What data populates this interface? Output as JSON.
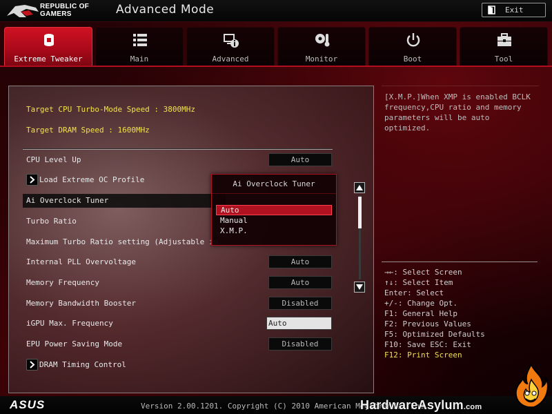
{
  "header": {
    "brand_line1": "REPUBLIC OF",
    "brand_line2": "GAMERS",
    "title": "Advanced Mode",
    "exit_label": "Exit"
  },
  "tabs": [
    {
      "label": "Extreme Tweaker",
      "icon": "tweaker-icon",
      "active": true
    },
    {
      "label": "Main",
      "icon": "list-icon",
      "active": false
    },
    {
      "label": "Advanced",
      "icon": "advanced-info-icon",
      "active": false
    },
    {
      "label": "Monitor",
      "icon": "thermometer-fan-icon",
      "active": false
    },
    {
      "label": "Boot",
      "icon": "power-icon",
      "active": false
    },
    {
      "label": "Tool",
      "icon": "toolbox-icon",
      "active": false
    }
  ],
  "main": {
    "info_lines": [
      "Target CPU Turbo-Mode Speed : 3800MHz",
      "Target DRAM Speed : 1600MHz"
    ],
    "settings": [
      {
        "label": "CPU Level Up",
        "value": "Auto"
      },
      {
        "label": "Load Extreme OC Profile",
        "submenu": true
      },
      {
        "label": "Ai Overclock Tuner",
        "highlighted": true
      },
      {
        "label": "Turbo Ratio"
      },
      {
        "label": "Maximum Turbo Ratio setting (Adjustable in"
      },
      {
        "label": "Internal PLL Overvoltage",
        "value": "Auto"
      },
      {
        "label": "Memory Frequency",
        "value": "Auto"
      },
      {
        "label": "Memory Bandwidth Booster",
        "value": "Disabled"
      },
      {
        "label": "iGPU Max. Frequency",
        "value": "Auto",
        "editable": true
      },
      {
        "label": "EPU Power Saving Mode",
        "value": "Disabled"
      },
      {
        "label": "DRAM Timing Control",
        "submenu": true
      }
    ]
  },
  "popup": {
    "title": "Ai Overclock Tuner",
    "options": [
      "Auto",
      "Manual",
      "X.M.P."
    ],
    "selected": "Auto"
  },
  "help": {
    "description": "[X.M.P.]When XMP is enabled BCLK\nfrequency,CPU ratio and memory\nparameters will be auto optimized.",
    "keys": [
      "→←: Select Screen",
      "↑↓: Select Item",
      "Enter: Select",
      "+/-: Change Opt.",
      "F1: General Help",
      "F2: Previous Values",
      "F5: Optimized Defaults",
      "F10: Save  ESC: Exit",
      "F12: Print Screen"
    ]
  },
  "footer": {
    "brand": "ASUS",
    "version": "Version 2.00.1201. Copyright (C) 2010 American Megatrends, Inc.",
    "watermark": "HardwareAsylum",
    "watermark_suffix": ".com"
  },
  "colors": {
    "accent_red": "#b0121f",
    "info_yellow": "#f2e24a"
  }
}
